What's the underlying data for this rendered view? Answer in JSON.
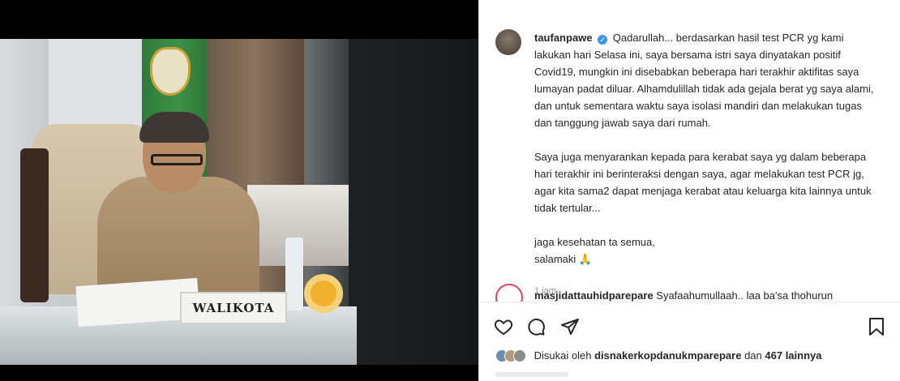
{
  "photo": {
    "nameplate": "WALIKOTA"
  },
  "post": {
    "username": "taufanpawe",
    "caption_paragraphs": [
      "Qadarullah... berdasarkan hasil test PCR yg kami lakukan hari Selasa ini, saya bersama istri saya dinyatakan positif Covid19, mungkin ini disebabkan beberapa hari terakhir aktifitas saya lumayan padat diluar. Alhamdulillah tidak ada gejala berat yg saya alami, dan untuk sementara waktu saya isolasi mandiri dan melakukan tugas dan tanggung jawab saya dari rumah.",
      "Saya juga menyarankan kepada para kerabat saya yg dalam beberapa hari terakhir ini berinteraksi dengan saya, agar melakukan test PCR jg, agar kita sama2 dapat menjaga kerabat atau keluarga kita lainnya untuk tidak tertular...",
      "jaga kesehatan ta semua,",
      "salamaki 🙏"
    ],
    "time": "1 jam"
  },
  "comment": {
    "username": "masjidattauhidparepare",
    "text": "Syafaahumullaah.. laa ba'sa thohurun"
  },
  "likes": {
    "prefix": "Disukai oleh",
    "user": "disnakerkopdanukmparepare",
    "joiner": "dan",
    "others": "467 lainnya"
  },
  "icons": [
    "heart-icon",
    "comment-icon",
    "share-icon",
    "bookmark-icon",
    "verified-icon"
  ],
  "colors": {
    "verified": "#3897f0",
    "story_ring": "#e4405f"
  }
}
